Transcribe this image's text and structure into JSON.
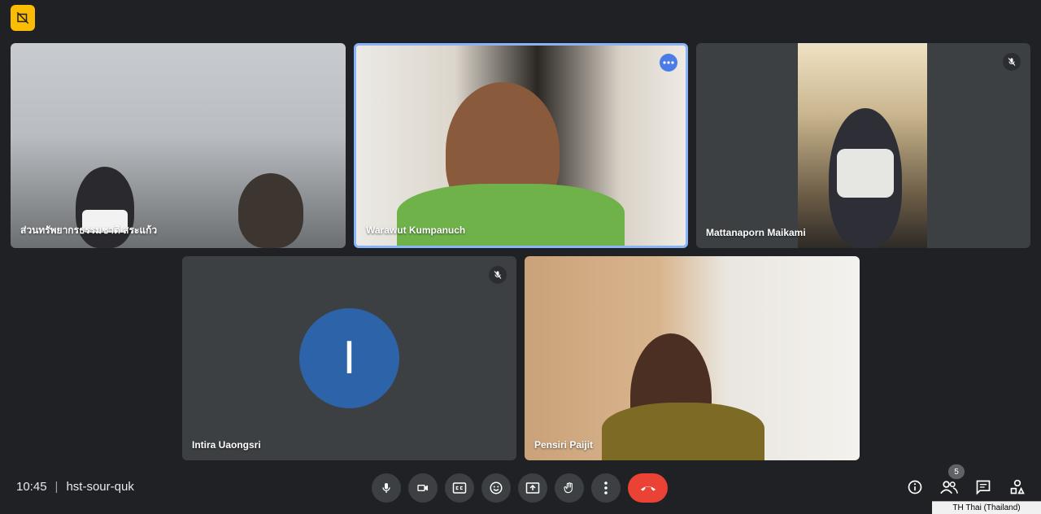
{
  "tiles": [
    {
      "name": "ส่วนทรัพยากรธรรมชาติ สระแก้ว"
    },
    {
      "name": "Warawut Kumpanuch"
    },
    {
      "name": "Mattanaporn Maikami"
    },
    {
      "name": "Intira Uaongsri",
      "initial": "I"
    },
    {
      "name": "Pensiri Paijit"
    }
  ],
  "meeting": {
    "time": "10:45",
    "separator": "|",
    "code": "hst-sour-quk"
  },
  "participants_count": "5",
  "language_indicator": "TH Thai (Thailand)",
  "colors": {
    "accent": "#8ab4f8",
    "end_call": "#ea4335",
    "avatar": "#2d63a8",
    "badge": "#fbbc04"
  },
  "icons": [
    "no-camera-icon",
    "mic-icon",
    "camera-icon",
    "captions-icon",
    "emoji-icon",
    "present-icon",
    "raise-hand-icon",
    "more-vert-icon",
    "end-call-icon",
    "info-icon",
    "people-icon",
    "chat-icon",
    "activities-icon",
    "mic-off-icon",
    "more-horiz-icon"
  ]
}
